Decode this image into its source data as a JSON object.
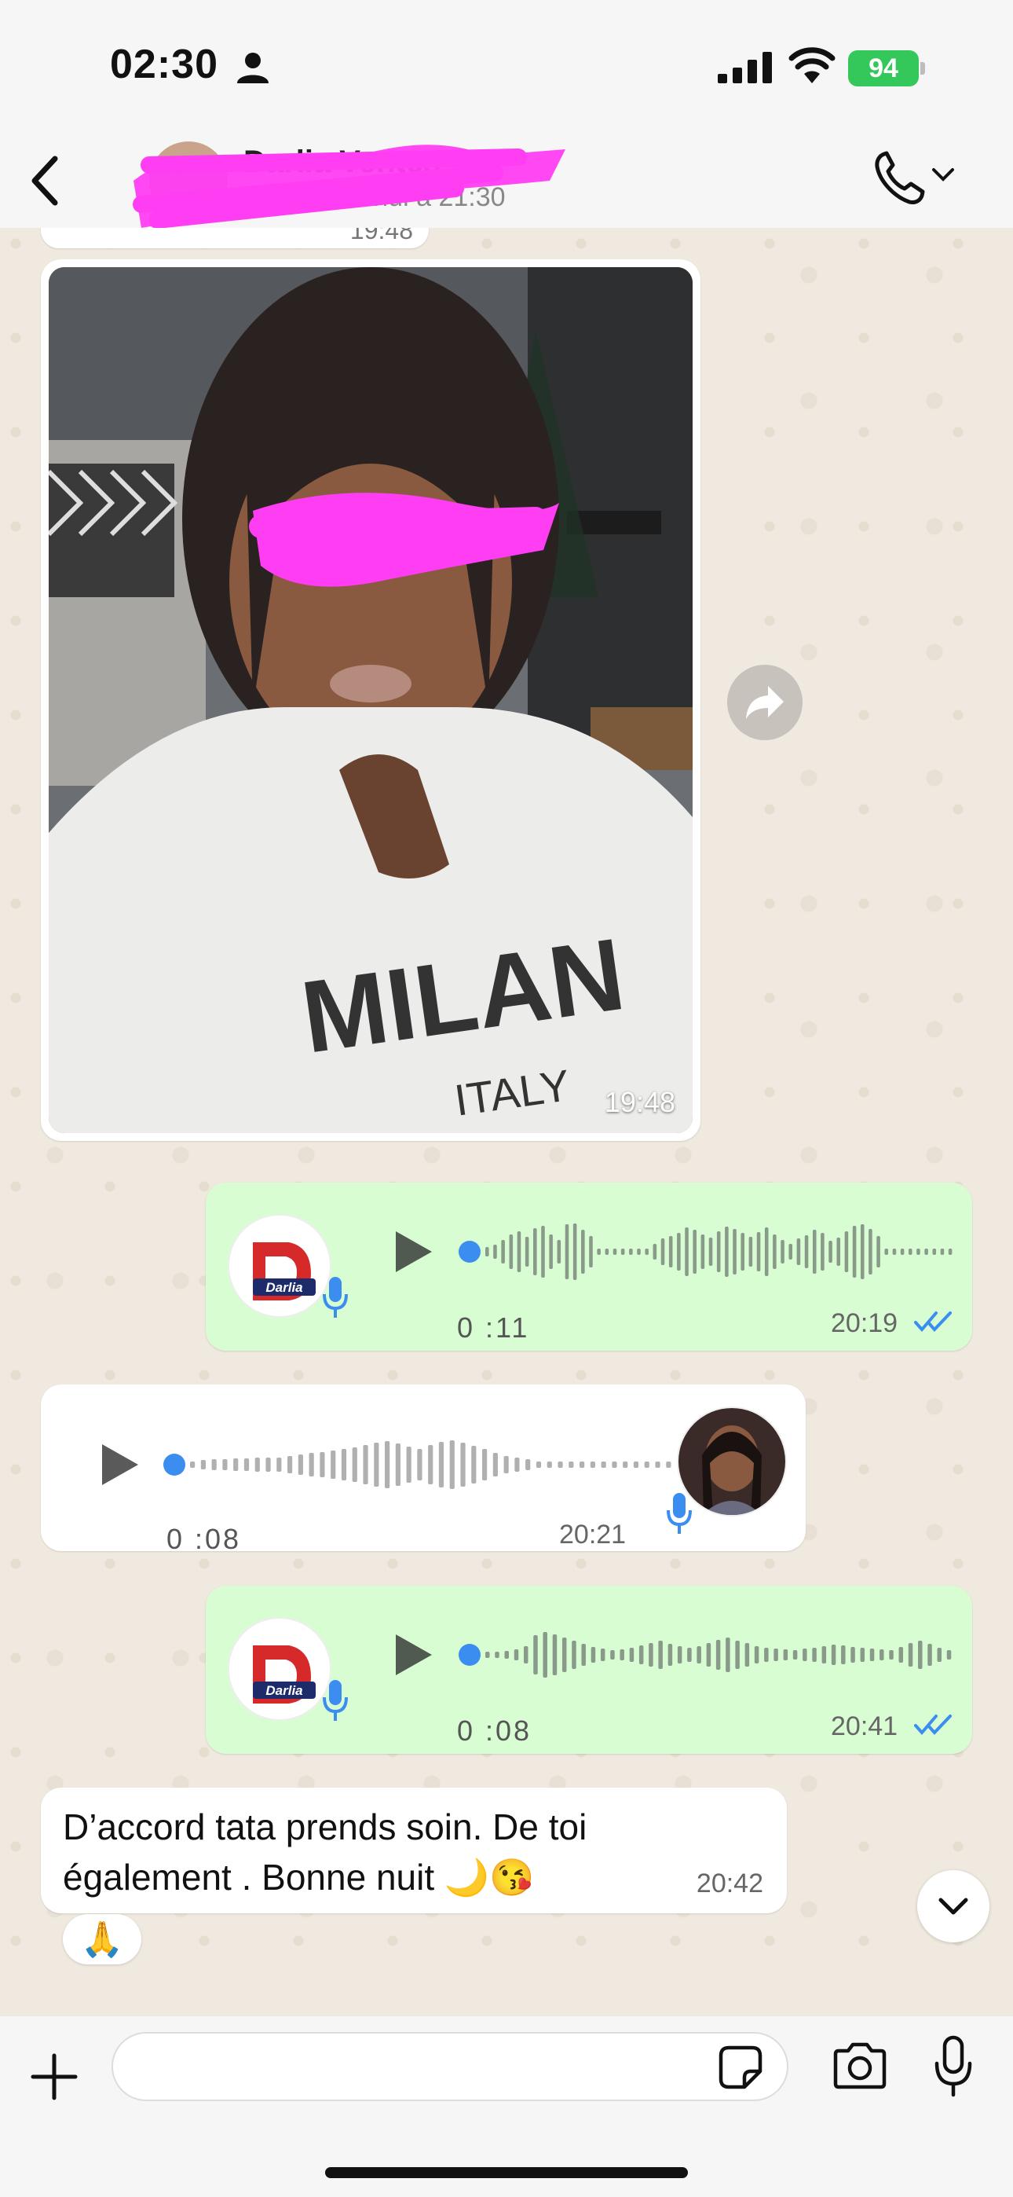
{
  "status_bar": {
    "time": "02:30",
    "battery": "94"
  },
  "header": {
    "contact_name": "Darlia Ventes",
    "last_seen": "vu aujourd'hui à 21:30",
    "call_icon": "phone-icon"
  },
  "messages": {
    "previous": {
      "time": "19:48"
    },
    "photo": {
      "time": "19:48",
      "shirt_text": "MILAN",
      "shirt_subtext": "ITALY"
    },
    "voice1": {
      "duration": "0 :11",
      "time": "20:19",
      "logo_text": "Darlia"
    },
    "voice2": {
      "duration": "0 :08",
      "time": "20:21"
    },
    "voice3": {
      "duration": "0 :08",
      "time": "20:41",
      "logo_text": "Darlia"
    },
    "text": {
      "line1": "D’accord tata prends soin. De toi",
      "line2": "également . Bonne nuit 🌙😘",
      "time": "20:42",
      "reaction": "🙏"
    }
  },
  "input": {
    "placeholder": ""
  },
  "colors": {
    "accent_blue": "#3b8ef0",
    "outgoing_bubble": "#d9fdd3",
    "redaction": "#ff3df3"
  }
}
